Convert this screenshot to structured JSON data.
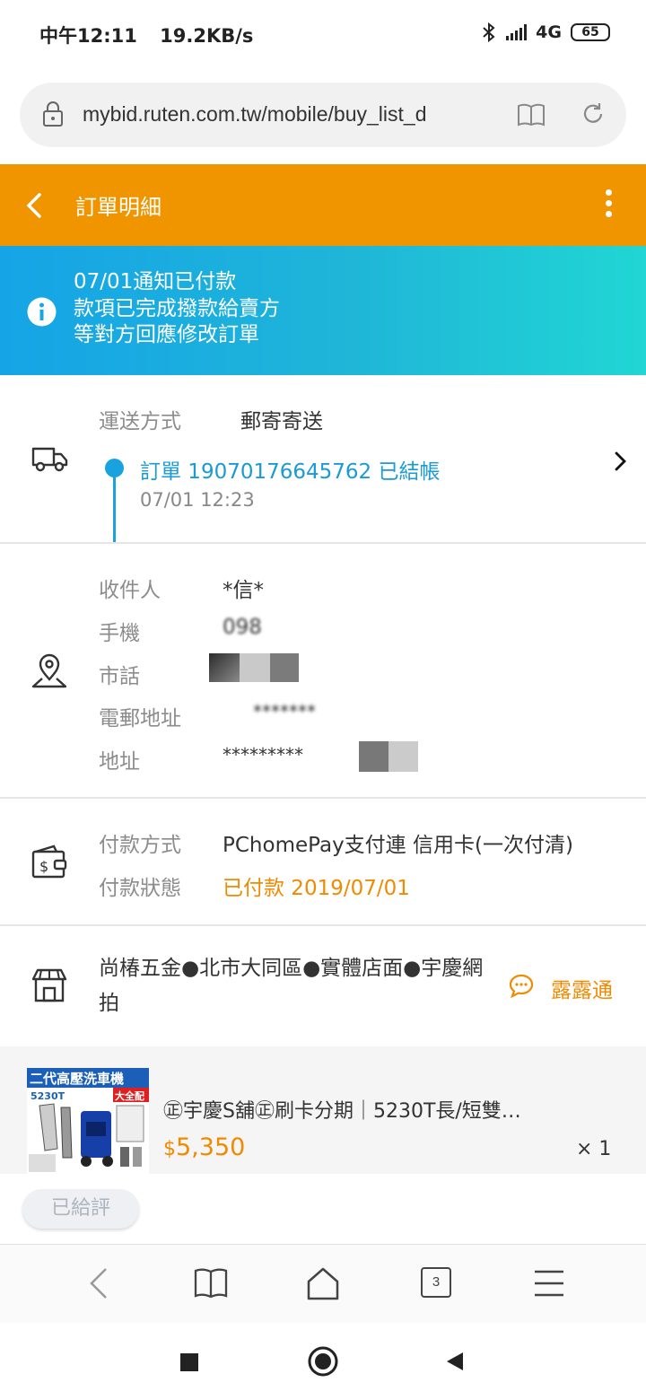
{
  "status_bar": {
    "time": "中午12:11",
    "net_speed": "19.2KB/s",
    "network": "4G",
    "battery": "65"
  },
  "browser": {
    "url": "mybid.ruten.com.tw/mobile/buy_list_d",
    "tab_count": "3"
  },
  "header": {
    "title": "訂單明細"
  },
  "notice": {
    "lines": [
      "07/01通知已付款",
      "款項已完成撥款給賣方",
      "等對方回應修改訂單"
    ]
  },
  "shipping": {
    "method_label": "運送方式",
    "method_value": "郵寄寄送",
    "order_status": "訂單 19070176645762 已結帳",
    "order_time": "07/01 12:23"
  },
  "recipient": {
    "name_label": "收件人",
    "name_value": "*信*",
    "mobile_label": "手機",
    "mobile_value": "098",
    "phone_label": "市話",
    "email_label": "電郵地址",
    "email_value": "*******",
    "address_label": "地址",
    "address_value": "*********"
  },
  "payment": {
    "method_label": "付款方式",
    "method_value": "PChomePay支付連 信用卡(一次付清)",
    "status_label": "付款狀態",
    "status_value": "已付款 2019/07/01"
  },
  "store": {
    "name": "尚椿五金●北市大同區●實體店面●宇慶網拍",
    "chat_label": "露露通"
  },
  "product": {
    "image_banner": "二代高壓洗車機",
    "image_tag": "大全配",
    "image_model": "5230T",
    "title": "㊣宇慶S舖㊣刷卡分期｜5230T長/短雙…",
    "currency": "$",
    "price": "5,350",
    "quantity": "× 1"
  },
  "actions": {
    "rated_label": "已給評"
  },
  "colors": {
    "header": "#f09400",
    "notice_start": "#15a4e6",
    "notice_end": "#21d6d4",
    "link": "#1a9ad6",
    "accent_orange": "#f08a00"
  }
}
